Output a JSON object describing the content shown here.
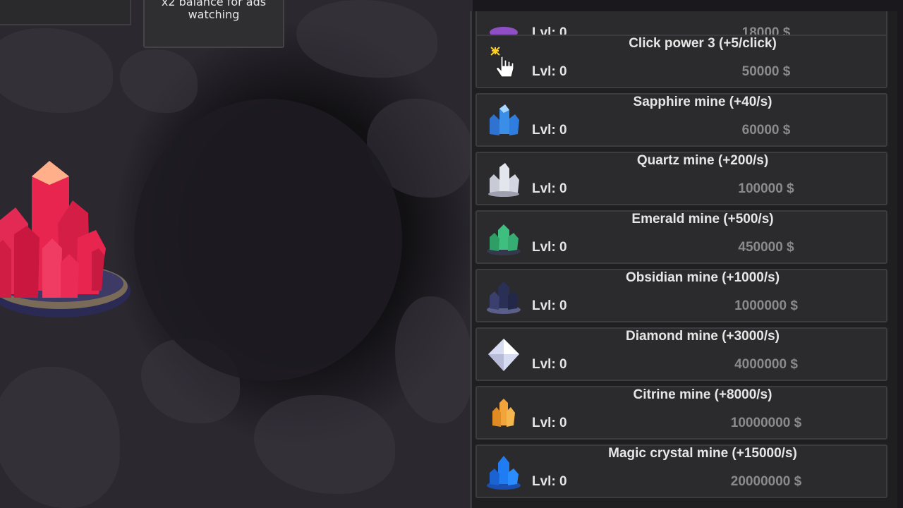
{
  "ads_button": {
    "label": "x2 balance for ads watching"
  },
  "shop": {
    "items": [
      {
        "title": "",
        "level": "Lvl: 0",
        "price": "18000 $",
        "icon": "purple-crystal-icon"
      },
      {
        "title": "Click power 3 (+5/click)",
        "level": "Lvl: 0",
        "price": "50000 $",
        "icon": "hand-cursor-icon"
      },
      {
        "title": "Sapphire mine (+40/s)",
        "level": "Lvl: 0",
        "price": "60000 $",
        "icon": "sapphire-icon"
      },
      {
        "title": "Quartz mine (+200/s)",
        "level": "Lvl: 0",
        "price": "100000 $",
        "icon": "quartz-icon"
      },
      {
        "title": "Emerald mine (+500/s)",
        "level": "Lvl: 0",
        "price": "450000 $",
        "icon": "emerald-icon"
      },
      {
        "title": "Obsidian mine (+1000/s)",
        "level": "Lvl: 0",
        "price": "1000000 $",
        "icon": "obsidian-icon"
      },
      {
        "title": "Diamond mine (+3000/s)",
        "level": "Lvl: 0",
        "price": "4000000 $",
        "icon": "diamond-icon"
      },
      {
        "title": "Citrine mine (+8000/s)",
        "level": "Lvl: 0",
        "price": "10000000 $",
        "icon": "citrine-icon"
      },
      {
        "title": "Magic crystal mine (+15000/s)",
        "level": "Lvl: 0",
        "price": "20000000 $",
        "icon": "magic-crystal-icon"
      }
    ]
  },
  "colors": {
    "ruby": "#e8254f",
    "sapphire": "#3a8ee8",
    "quartz": "#e4e6ee",
    "emerald": "#3fbf7f",
    "obsidian": "#2a2f55",
    "diamond": "#d8dcf2",
    "citrine": "#f2a43a",
    "magic": "#1f7cf2",
    "purple": "#8e4fc4"
  }
}
